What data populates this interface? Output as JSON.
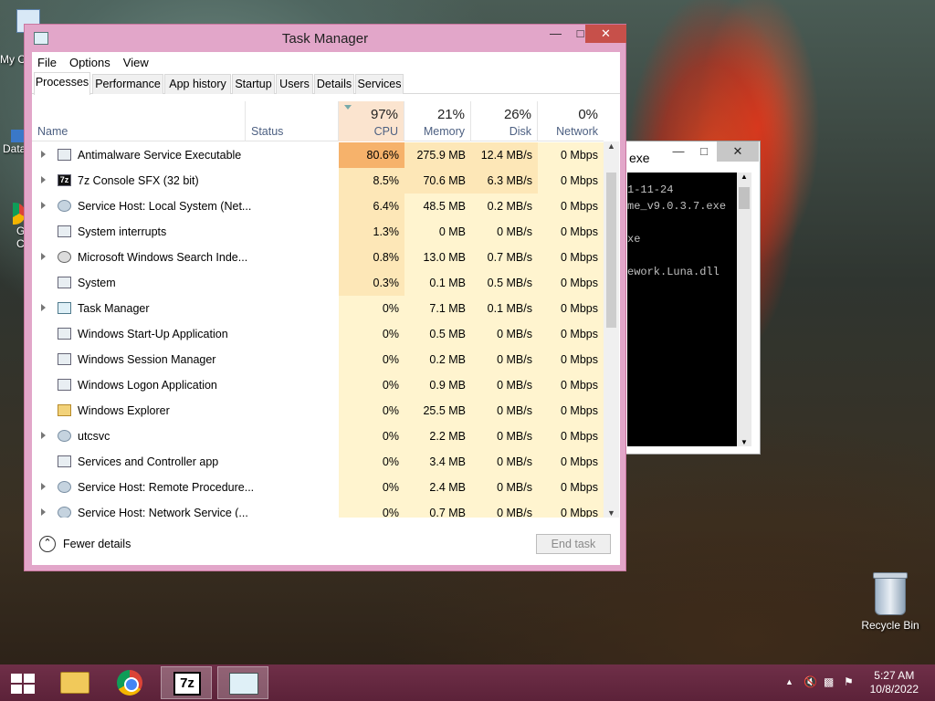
{
  "desktop": {
    "left_labels": [
      "My C",
      "Data",
      "G",
      "C"
    ],
    "recycle_bin_label": "Recycle Bin"
  },
  "console": {
    "title": "exe",
    "lines": [
      "1-11-24",
      "me_v9.0.3.7.exe",
      "",
      "xe",
      "",
      "ework.Luna.dll"
    ]
  },
  "task_manager": {
    "title": "Task Manager",
    "menu": [
      "File",
      "Options",
      "View"
    ],
    "tabs": [
      "Processes",
      "Performance",
      "App history",
      "Startup",
      "Users",
      "Details",
      "Services"
    ],
    "active_tab": "Processes",
    "columns": {
      "name": "Name",
      "status": "Status",
      "cpu": {
        "percent": "97%",
        "label": "CPU"
      },
      "memory": {
        "percent": "21%",
        "label": "Memory"
      },
      "disk": {
        "percent": "26%",
        "label": "Disk"
      },
      "network": {
        "percent": "0%",
        "label": "Network"
      }
    },
    "processes": [
      {
        "name": "Antimalware Service Executable",
        "icon": "app-window-icon",
        "expandable": true,
        "cpu": "80.6%",
        "memory": "275.9 MB",
        "disk": "12.4 MB/s",
        "network": "0 Mbps"
      },
      {
        "name": "7z Console SFX (32 bit)",
        "icon": "7z-icon",
        "expandable": true,
        "cpu": "8.5%",
        "memory": "70.6 MB",
        "disk": "6.3 MB/s",
        "network": "0 Mbps"
      },
      {
        "name": "Service Host: Local System (Net...",
        "icon": "gear-icon",
        "expandable": true,
        "cpu": "6.4%",
        "memory": "48.5 MB",
        "disk": "0.2 MB/s",
        "network": "0 Mbps"
      },
      {
        "name": "System interrupts",
        "icon": "app-window-icon",
        "expandable": false,
        "cpu": "1.3%",
        "memory": "0 MB",
        "disk": "0 MB/s",
        "network": "0 Mbps"
      },
      {
        "name": "Microsoft Windows Search Inde...",
        "icon": "search-indexer-icon",
        "expandable": true,
        "cpu": "0.8%",
        "memory": "13.0 MB",
        "disk": "0.7 MB/s",
        "network": "0 Mbps"
      },
      {
        "name": "System",
        "icon": "app-window-icon",
        "expandable": false,
        "cpu": "0.3%",
        "memory": "0.1 MB",
        "disk": "0.5 MB/s",
        "network": "0 Mbps"
      },
      {
        "name": "Task Manager",
        "icon": "task-manager-icon",
        "expandable": true,
        "cpu": "0%",
        "memory": "7.1 MB",
        "disk": "0.1 MB/s",
        "network": "0 Mbps"
      },
      {
        "name": "Windows Start-Up Application",
        "icon": "app-window-icon",
        "expandable": false,
        "cpu": "0%",
        "memory": "0.5 MB",
        "disk": "0 MB/s",
        "network": "0 Mbps"
      },
      {
        "name": "Windows Session Manager",
        "icon": "app-window-icon",
        "expandable": false,
        "cpu": "0%",
        "memory": "0.2 MB",
        "disk": "0 MB/s",
        "network": "0 Mbps"
      },
      {
        "name": "Windows Logon Application",
        "icon": "app-window-icon",
        "expandable": false,
        "cpu": "0%",
        "memory": "0.9 MB",
        "disk": "0 MB/s",
        "network": "0 Mbps"
      },
      {
        "name": "Windows Explorer",
        "icon": "folder-icon",
        "expandable": false,
        "cpu": "0%",
        "memory": "25.5 MB",
        "disk": "0 MB/s",
        "network": "0 Mbps"
      },
      {
        "name": "utcsvc",
        "icon": "gear-icon",
        "expandable": true,
        "cpu": "0%",
        "memory": "2.2 MB",
        "disk": "0 MB/s",
        "network": "0 Mbps"
      },
      {
        "name": "Services and Controller app",
        "icon": "app-window-icon",
        "expandable": false,
        "cpu": "0%",
        "memory": "3.4 MB",
        "disk": "0 MB/s",
        "network": "0 Mbps"
      },
      {
        "name": "Service Host: Remote Procedure...",
        "icon": "gear-icon",
        "expandable": true,
        "cpu": "0%",
        "memory": "2.4 MB",
        "disk": "0 MB/s",
        "network": "0 Mbps"
      },
      {
        "name": "Service Host: Network Service (...",
        "icon": "gear-icon",
        "expandable": true,
        "cpu": "0%",
        "memory": "0.7 MB",
        "disk": "0 MB/s",
        "network": "0 Mbps"
      }
    ],
    "fewer_details": "Fewer details",
    "end_task": "End task"
  },
  "colors": {
    "cpu_high": "#f6b26b",
    "cpu_mid": "#fde7b7",
    "cpu_low": "#fff4cf",
    "window_border": "#e2a6c9",
    "taskbar": "#5c2239"
  },
  "taskbar": {
    "items": [
      "start-icon",
      "file-explorer-icon",
      "chrome-icon",
      "7z-icon",
      "task-manager-icon"
    ],
    "time": "5:27 AM",
    "date": "10/8/2022"
  }
}
